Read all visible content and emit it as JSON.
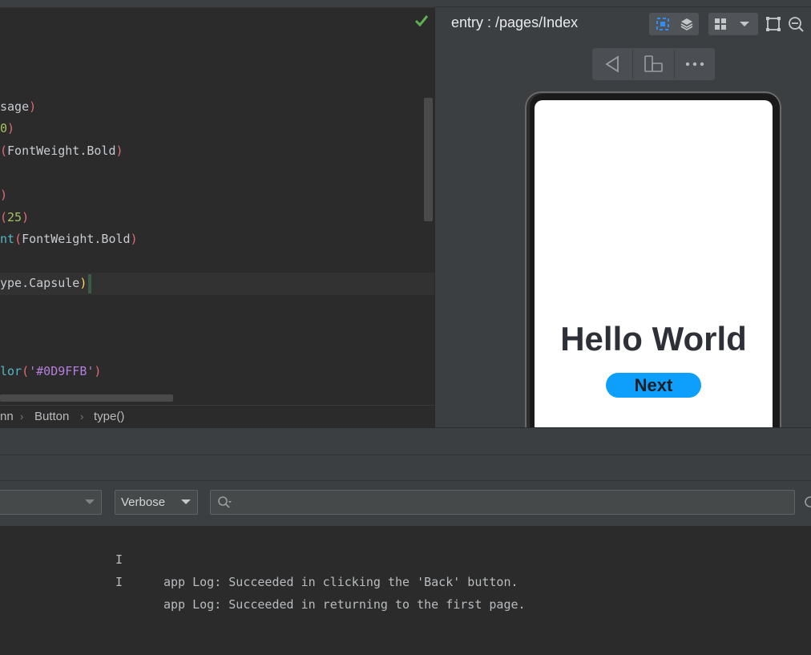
{
  "editor": {
    "lines": [
      [
        {
          "t": "sage",
          "c": "c-text"
        },
        {
          "t": ")",
          "c": "c-paren"
        }
      ],
      [
        {
          "t": "0",
          "c": "c-num"
        },
        {
          "t": ")",
          "c": "c-paren"
        }
      ],
      [
        {
          "t": "(",
          "c": "c-paren"
        },
        {
          "t": "FontWeight.Bold",
          "c": "c-text"
        },
        {
          "t": ")",
          "c": "c-paren"
        }
      ],
      [
        {
          "t": ")",
          "c": "c-paren"
        }
      ],
      [
        {
          "t": "(",
          "c": "c-paren"
        },
        {
          "t": "25",
          "c": "c-num"
        },
        {
          "t": ")",
          "c": "c-paren"
        }
      ],
      [
        {
          "t": "nt",
          "c": "c-fn"
        },
        {
          "t": "(",
          "c": "c-paren"
        },
        {
          "t": "FontWeight.Bold",
          "c": "c-text"
        },
        {
          "t": ")",
          "c": "c-paren"
        }
      ],
      [
        {
          "t": "ype.Capsule",
          "c": "c-text"
        },
        {
          "t": ")",
          "c": "c-yel"
        }
      ],
      [
        {
          "t": "lor",
          "c": "c-fn"
        },
        {
          "t": "(",
          "c": "c-paren"
        },
        {
          "t": "'#0D9FFB'",
          "c": "c-str"
        },
        {
          "t": ")",
          "c": "c-paren"
        }
      ]
    ],
    "status_icon": "check-icon",
    "breadcrumb": [
      "nn",
      "Button",
      "type()"
    ]
  },
  "preview": {
    "title": "entry : /pages/Index",
    "toolbar_icons": [
      "inspector-icon",
      "layers-icon",
      "grid-icon",
      "dropdown-arrow-icon",
      "crop-icon",
      "zoom-out-icon"
    ],
    "nav_icons": [
      "back-triangle-icon",
      "device-rotate-icon",
      "more-icon"
    ],
    "app": {
      "heading": "Hello World",
      "button_label": "Next",
      "button_color": "#0D9FFB"
    }
  },
  "log": {
    "process_value": "",
    "level": "Verbose",
    "search_value": "",
    "search_placeholder": "",
    "entries": [
      {
        "level": "I",
        "message": "app Log: Succeeded in clicking the 'Back' button."
      },
      {
        "level": "I",
        "message": "app Log: Succeeded in returning to the first page."
      }
    ]
  }
}
